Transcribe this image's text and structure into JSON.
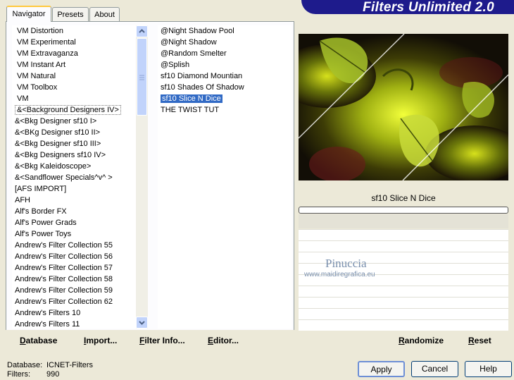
{
  "banner": {
    "title": "Filters Unlimited 2.0"
  },
  "tabs": [
    {
      "label": "Navigator"
    },
    {
      "label": "Presets"
    },
    {
      "label": "About"
    }
  ],
  "categories": [
    "VM Distortion",
    "VM Experimental",
    "VM Extravaganza",
    "VM Instant Art",
    "VM Natural",
    "VM Toolbox",
    "VM",
    "&<Background Designers IV>",
    "&<Bkg Designer sf10 I>",
    "&<BKg Designer sf10 II>",
    "&<Bkg Designer sf10 III>",
    "&<Bkg Designers sf10 IV>",
    "&<Bkg Kaleidoscope>",
    "&<Sandflower Specials^v^ >",
    "[AFS IMPORT]",
    "AFH",
    "Alf's Border FX",
    "Alf's Power Grads",
    "Alf's Power Toys",
    "Andrew's Filter Collection 55",
    "Andrew's Filter Collection 56",
    "Andrew's Filter Collection 57",
    "Andrew's Filter Collection 58",
    "Andrew's Filter Collection 59",
    "Andrew's Filter Collection 62",
    "Andrew's Filters 10",
    "Andrew's Filters 11"
  ],
  "selected_category_index": 7,
  "filters": [
    "@Night Shadow Pool",
    "@Night Shadow",
    "@Random Smelter",
    "@Splish",
    "sf10 Diamond Mountian",
    "sf10 Shades Of Shadow",
    "sf10 Slice N Dice",
    "THE TWIST TUT"
  ],
  "selected_filter_index": 6,
  "preview": {
    "filter_name": "sf10 Slice N Dice",
    "progress": 0,
    "watermark": "Pinuccia",
    "watermark_url": "www.maidiregrafica.eu"
  },
  "toolbar": {
    "database": "Database",
    "import": "Import...",
    "filter_info": "Filter Info...",
    "editor": "Editor...",
    "randomize": "Randomize",
    "reset": "Reset"
  },
  "status": {
    "database_label": "Database:",
    "database_value": "ICNET-Filters",
    "filters_label": "Filters:",
    "filters_value": "990"
  },
  "buttons": {
    "apply": "Apply",
    "cancel": "Cancel",
    "help": "Help"
  },
  "colors": {
    "banner": "#1e1b8c",
    "selection": "#316ac5",
    "face": "#ece9d8"
  }
}
